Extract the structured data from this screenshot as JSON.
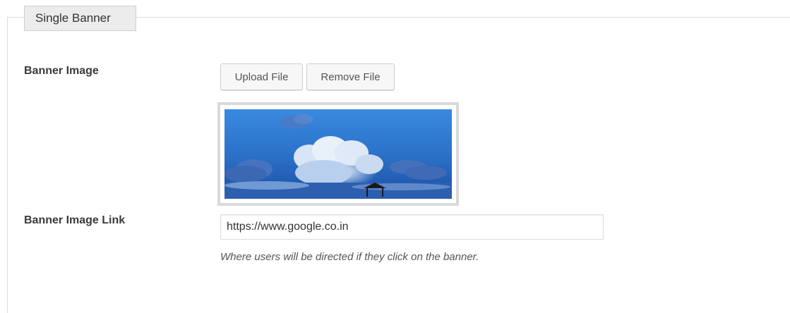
{
  "section": {
    "legend": "Single Banner"
  },
  "banner_image": {
    "label": "Banner Image",
    "upload_label": "Upload File",
    "remove_label": "Remove File",
    "preview_description": "sky with clouds and a thatched hut silhouette"
  },
  "banner_link": {
    "label": "Banner Image Link",
    "value": "https://www.google.co.in",
    "description": "Where users will be directed if they click on the banner."
  },
  "colors": {
    "sky_top": "#2f7fd2",
    "sky_bottom": "#1a4fa8",
    "cloud": "#dfe9f7"
  }
}
